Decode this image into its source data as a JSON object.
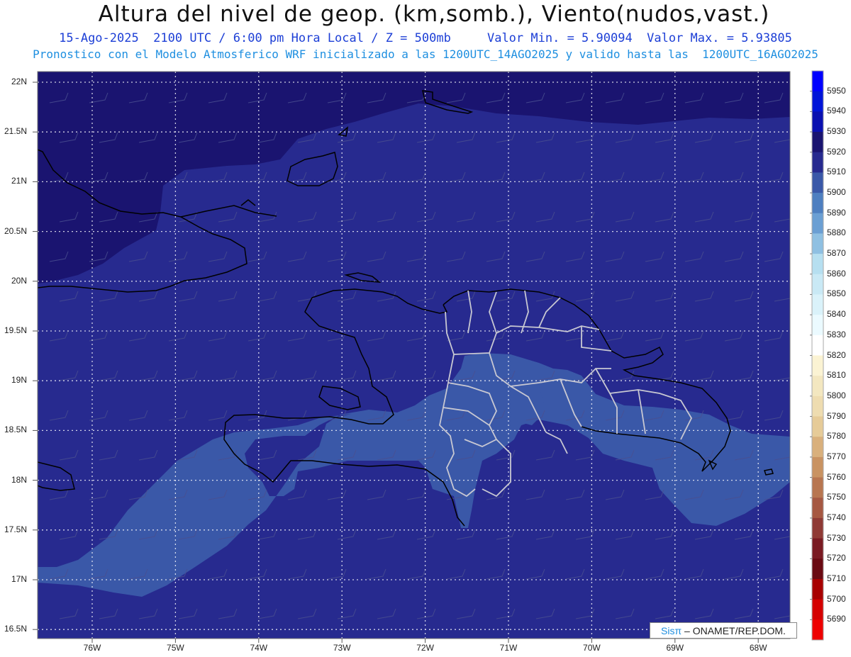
{
  "header": {
    "title": "Altura del nivel de geop. (km,somb.), Viento(nudos,vast.)",
    "subtitle": "15-Ago-2025  2100 UTC / 6:00 pm Hora Local / Z = 500mb     Valor Min. = 5.90094  Valor Max. = 5.93805",
    "info": "Pronostico con el Modelo Atmosferico WRF inicializado a las 1200UTC_14AGO2025 y valido hasta las  1200UTC_16AGO2025"
  },
  "axes": {
    "lat_labels": [
      "22N",
      "21.5N",
      "21N",
      "20.5N",
      "20N",
      "19.5N",
      "19N",
      "18.5N",
      "18N",
      "17.5N",
      "17N",
      "16.5N"
    ],
    "lon_labels": [
      "76W",
      "75W",
      "74W",
      "73W",
      "72W",
      "71W",
      "70W",
      "69W",
      "68W"
    ]
  },
  "colorbar": {
    "levels": [
      5950,
      5940,
      5930,
      5920,
      5910,
      5900,
      5890,
      5880,
      5870,
      5860,
      5850,
      5840,
      5830,
      5820,
      5810,
      5800,
      5790,
      5780,
      5770,
      5760,
      5750,
      5740,
      5730,
      5720,
      5710,
      5700,
      5690
    ],
    "colors": [
      "#0000ff",
      "#0014d8",
      "#0a10b0",
      "#1a1470",
      "#272a8f",
      "#3a58a8",
      "#4e7fc0",
      "#6b9fd3",
      "#8fc0e2",
      "#b6dff0",
      "#c9e9f5",
      "#daf2fa",
      "#ebfaff",
      "#ffffff",
      "#fbf3d3",
      "#f3e7c0",
      "#eedcb0",
      "#e6cb98",
      "#d9b07c",
      "#c99362",
      "#b87650",
      "#a65842",
      "#8f3a35",
      "#7a1a22",
      "#6a0a12",
      "#a80000",
      "#d50000",
      "#ee0000"
    ]
  },
  "map": {
    "colors": {
      "shade_5920": "#1a1470",
      "shade_5910": "#272a8f",
      "shade_5900": "#3a58a8",
      "coast": "#000000",
      "provinces": "#bcbcc8",
      "grid": "#ffffff"
    }
  },
  "credit": {
    "sis": "Sisπ",
    "text": " – ONAMET/REP.DOM."
  }
}
